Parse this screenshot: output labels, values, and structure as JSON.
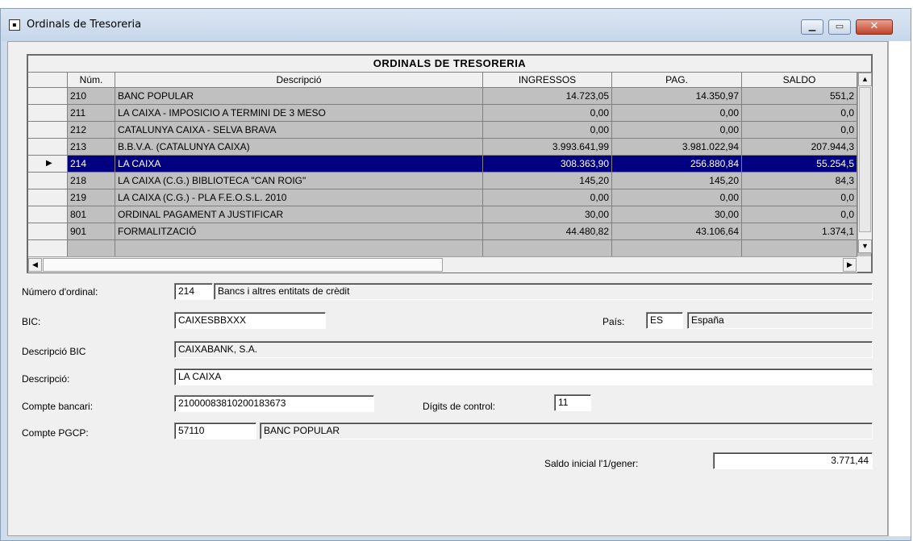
{
  "window": {
    "title": "Ordinals de Tresoreria"
  },
  "grid": {
    "title": "ORDINALS DE TRESORERIA",
    "columns": [
      "Núm.",
      "Descripció",
      "INGRESSOS",
      "PAG.",
      "SALDO"
    ],
    "rows": [
      {
        "num": "210",
        "desc": "BANC POPULAR",
        "ingressos": "14.723,05",
        "pag": "14.350,97",
        "saldo": "551,2"
      },
      {
        "num": "211",
        "desc": "LA CAIXA - IMPOSICIO A TERMINI DE 3 MESO",
        "ingressos": "0,00",
        "pag": "0,00",
        "saldo": "0,0"
      },
      {
        "num": "212",
        "desc": "CATALUNYA CAIXA - SELVA BRAVA",
        "ingressos": "0,00",
        "pag": "0,00",
        "saldo": "0,0"
      },
      {
        "num": "213",
        "desc": "B.B.V.A. (CATALUNYA CAIXA)",
        "ingressos": "3.993.641,99",
        "pag": "3.981.022,94",
        "saldo": "207.944,3"
      },
      {
        "num": "214",
        "desc": "LA CAIXA",
        "ingressos": "308.363,90",
        "pag": "256.880,84",
        "saldo": "55.254,5",
        "selected": true
      },
      {
        "num": "218",
        "desc": "LA CAIXA (C.G.) BIBLIOTECA \"CAN ROIG\"",
        "ingressos": "145,20",
        "pag": "145,20",
        "saldo": "84,3"
      },
      {
        "num": "219",
        "desc": "LA CAIXA (C.G.) - PLA F.E.O.S.L. 2010",
        "ingressos": "0,00",
        "pag": "0,00",
        "saldo": "0,0"
      },
      {
        "num": "801",
        "desc": "ORDINAL PAGAMENT A JUSTIFICAR",
        "ingressos": "30,00",
        "pag": "30,00",
        "saldo": "0,0"
      },
      {
        "num": "901",
        "desc": "FORMALITZACIÓ",
        "ingressos": "44.480,82",
        "pag": "43.106,64",
        "saldo": "1.374,1"
      },
      {
        "num": "",
        "desc": "",
        "ingressos": "",
        "pag": "",
        "saldo": ""
      }
    ]
  },
  "form": {
    "numero_label": "Número d'ordinal:",
    "numero_value": "214",
    "numero_desc": "Bancs i altres entitats de crèdit",
    "bic_label": "BIC:",
    "bic_value": "CAIXESBBXXX",
    "pais_label": "País:",
    "pais_code": "ES",
    "pais_name": "España",
    "desc_bic_label": "Descripció BIC",
    "desc_bic_value": "CAIXABANK, S.A.",
    "descripcio_label": "Descripció:",
    "descripcio_value": "LA CAIXA",
    "compte_label": "Compte bancari:",
    "compte_value": "21000083810200183673",
    "digits_label": "Dígits de control:",
    "digits_value": "11",
    "pgcp_label": "Compte PGCP:",
    "pgcp_value": "57110",
    "pgcp_desc": "BANC POPULAR",
    "saldo_label": "Saldo inicial l'1/gener:",
    "saldo_value": "3.771,44"
  }
}
